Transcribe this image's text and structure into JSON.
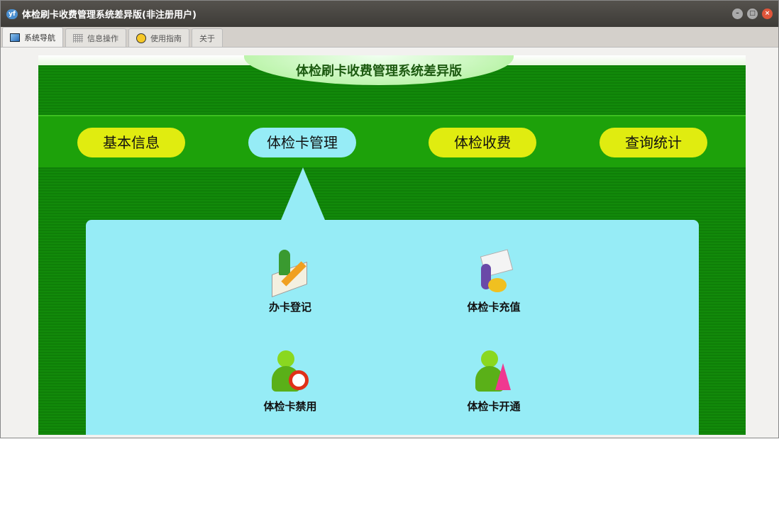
{
  "window": {
    "title": "体检刷卡收费管理系统差异版(非注册用户)",
    "logo": "yf"
  },
  "tabs": [
    {
      "label": "系统导航"
    },
    {
      "label": "信息操作"
    },
    {
      "label": "使用指南"
    },
    {
      "label": "关于"
    }
  ],
  "banner": "体检刷卡收费管理系统差异版",
  "nav": [
    {
      "label": "基本信息"
    },
    {
      "label": "体检卡管理"
    },
    {
      "label": "体检收费"
    },
    {
      "label": "查询统计"
    }
  ],
  "items": [
    {
      "label": "办卡登记"
    },
    {
      "label": "体检卡充值"
    },
    {
      "label": "体检卡禁用"
    },
    {
      "label": "体检卡开通"
    }
  ]
}
